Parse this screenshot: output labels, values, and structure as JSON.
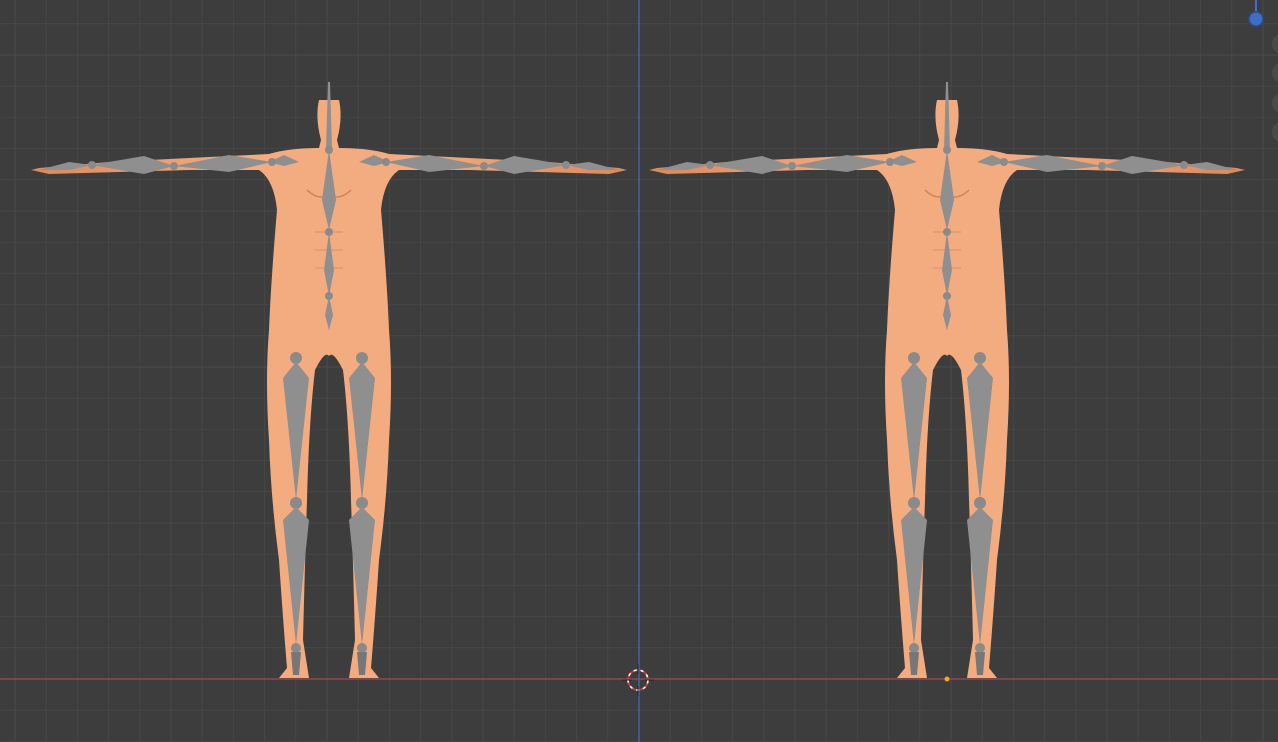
{
  "app": "3D Viewport",
  "view": "front-orthographic",
  "colors": {
    "background": "#3d3d3d",
    "grid_minor": "#464646",
    "grid_major": "#4c4c4c",
    "axis_x": "#c5475a",
    "axis_z": "#3f6fc4",
    "skin": "#f0a57a",
    "skin_shadow": "#d9895f",
    "bone": "#8f8f8f",
    "bone_dark": "#6f6f6f",
    "origin_dot": "#f5a623"
  },
  "objects": [
    {
      "name": "armature-mesh-left",
      "type": "armature-with-mesh"
    },
    {
      "name": "armature-mesh-right",
      "type": "armature-with-mesh"
    }
  ],
  "icons": [
    "3d-cursor-icon",
    "gizmo-z-axis-icon",
    "nav-zoom-icon",
    "nav-pan-icon",
    "nav-camera-icon",
    "nav-perspective-icon"
  ]
}
